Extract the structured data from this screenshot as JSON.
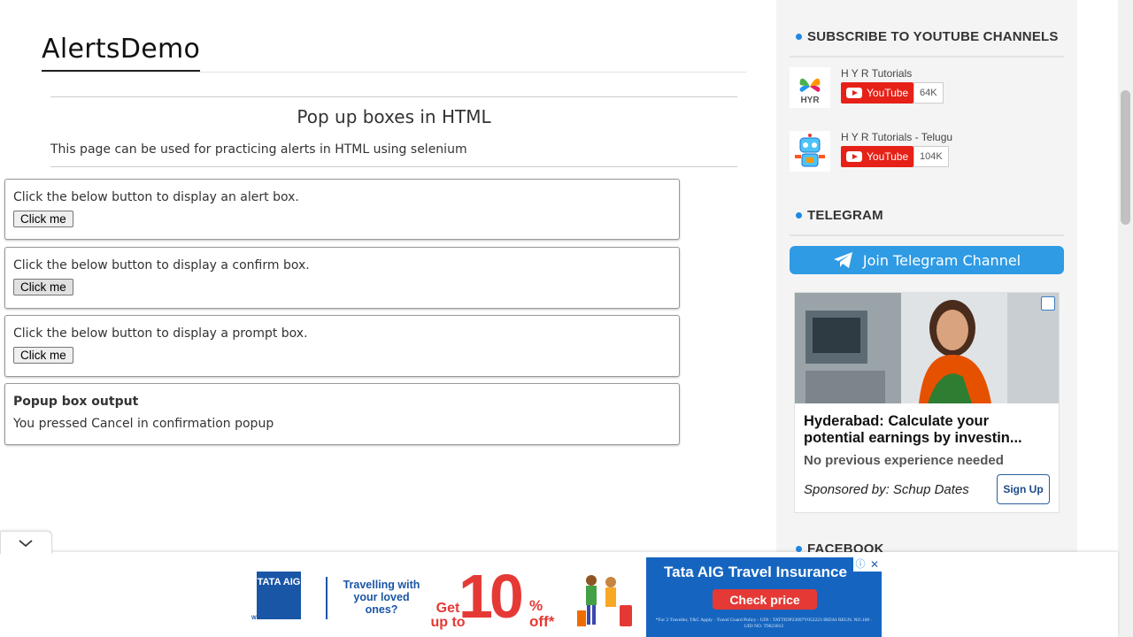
{
  "page": {
    "title": "AlertsDemo"
  },
  "post": {
    "heading": "Pop up boxes in HTML",
    "intro": "This page can be used for practicing alerts in HTML using selenium",
    "alert_box": {
      "text": "Click the below button to display an alert box.",
      "button": "Click me"
    },
    "confirm_box": {
      "text": "Click the below button to display a confirm box.",
      "button": "Click me"
    },
    "prompt_box": {
      "text": "Click the below button to display a prompt box.",
      "button": "Click me"
    },
    "output": {
      "title": "Popup box output",
      "text": "You pressed Cancel in confirmation popup"
    }
  },
  "sidebar": {
    "youtube": {
      "heading": "SUBSCRIBE TO YOUTUBE CHANNELS",
      "channels": [
        {
          "name": "H Y R Tutorials",
          "button": "YouTube",
          "subscribers": "64K"
        },
        {
          "name": "H Y R Tutorials - Telugu",
          "button": "YouTube",
          "subscribers": "104K"
        }
      ]
    },
    "telegram": {
      "heading": "TELEGRAM",
      "button": "Join Telegram Channel"
    },
    "ad": {
      "headline": "Hyderabad: Calculate your potential earnings by investin...",
      "subline": "No previous experience needed",
      "sponsor": "Sponsored by: Schup Dates",
      "cta": "Sign Up"
    },
    "facebook": {
      "heading": "FACEBOOK"
    }
  },
  "banner_ad": {
    "brand": "TATA AIG",
    "brand_sub": "WITH YOU ALWAYS",
    "tagline": "Travelling with your loved ones?",
    "get": "Get up to",
    "big": "10",
    "off": "% off*",
    "title": "Tata AIG Travel Insurance",
    "cta": "Check price",
    "fine_print": "*For 3 Traveller, T&C Apply · Travel Guard Policy - UIN : TATTIOP23097V052223 IRDAI REGN. NO.108 · UID NO. T9623012"
  },
  "colors": {
    "accent": "#1e88e5",
    "youtube": "#e62117",
    "telegram": "#2f9be5",
    "banner_blue": "#1565c0",
    "banner_red": "#e53935"
  }
}
